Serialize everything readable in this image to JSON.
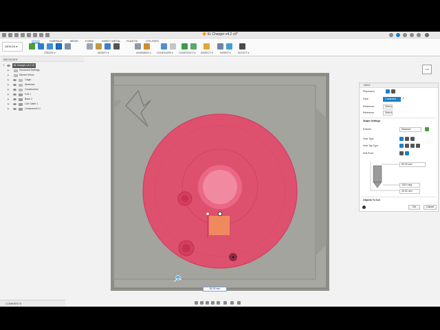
{
  "window": {
    "title": "🔶 5L Charger v4.2 v3*"
  },
  "ribbon": {
    "workspace_label": "DESIGN ▾",
    "tabs": [
      "SOLID",
      "SURFACE",
      "MESH",
      "FORM",
      "SHEET METAL",
      "PLASTIC",
      "UTILITIES"
    ],
    "active_tab": "SOLID",
    "groups": [
      "CREATE ▾",
      "MODIFY ▾",
      "ASSEMBLE ▾",
      "CONFIGURE ▾",
      "CONSTRUCT ▾",
      "INSPECT ▾",
      "INSERT ▾",
      "SELECT ▾"
    ]
  },
  "browser": {
    "title": "BROWSER",
    "root": "5L Charger v4.2 v3",
    "items": [
      "Document Settings",
      "Named Views",
      "Origin",
      "Sketches",
      "Construction",
      "Coil 1",
      "Base 2",
      "Coil Cable 1",
      "Component1:1"
    ]
  },
  "bottom": {
    "comments_label": "COMMENTS"
  },
  "viewcube": {
    "label": "TOP"
  },
  "hole_panel": {
    "title": "HOLE",
    "placement_label": "Placement",
    "face_label": "Face",
    "face_value": "1 selected",
    "reference1_label": "Reference",
    "reference1_value": "Select",
    "reference2_label": "Reference",
    "reference2_value": "Select",
    "shape_section": "Shape Settings",
    "extents_label": "Extents",
    "extents_value": "Distance",
    "hole_type_label": "Hole Type",
    "hole_tap_type_label": "Hole Tap Type",
    "drill_point_label": "Drill Point",
    "dim_diameter": "82.00 mm",
    "dim_angle": "118.0 deg",
    "dim_depth": "40.00 mm",
    "objects_section": "Objects To Cut",
    "ok_label": "OK",
    "cancel_label": "Cancel"
  },
  "canvas": {
    "dimension_input": "82.00 mm"
  },
  "colors": {
    "accent": "#0a70c0",
    "hole_preview": "#e24a6a",
    "model_gray": "#a3a49d"
  }
}
